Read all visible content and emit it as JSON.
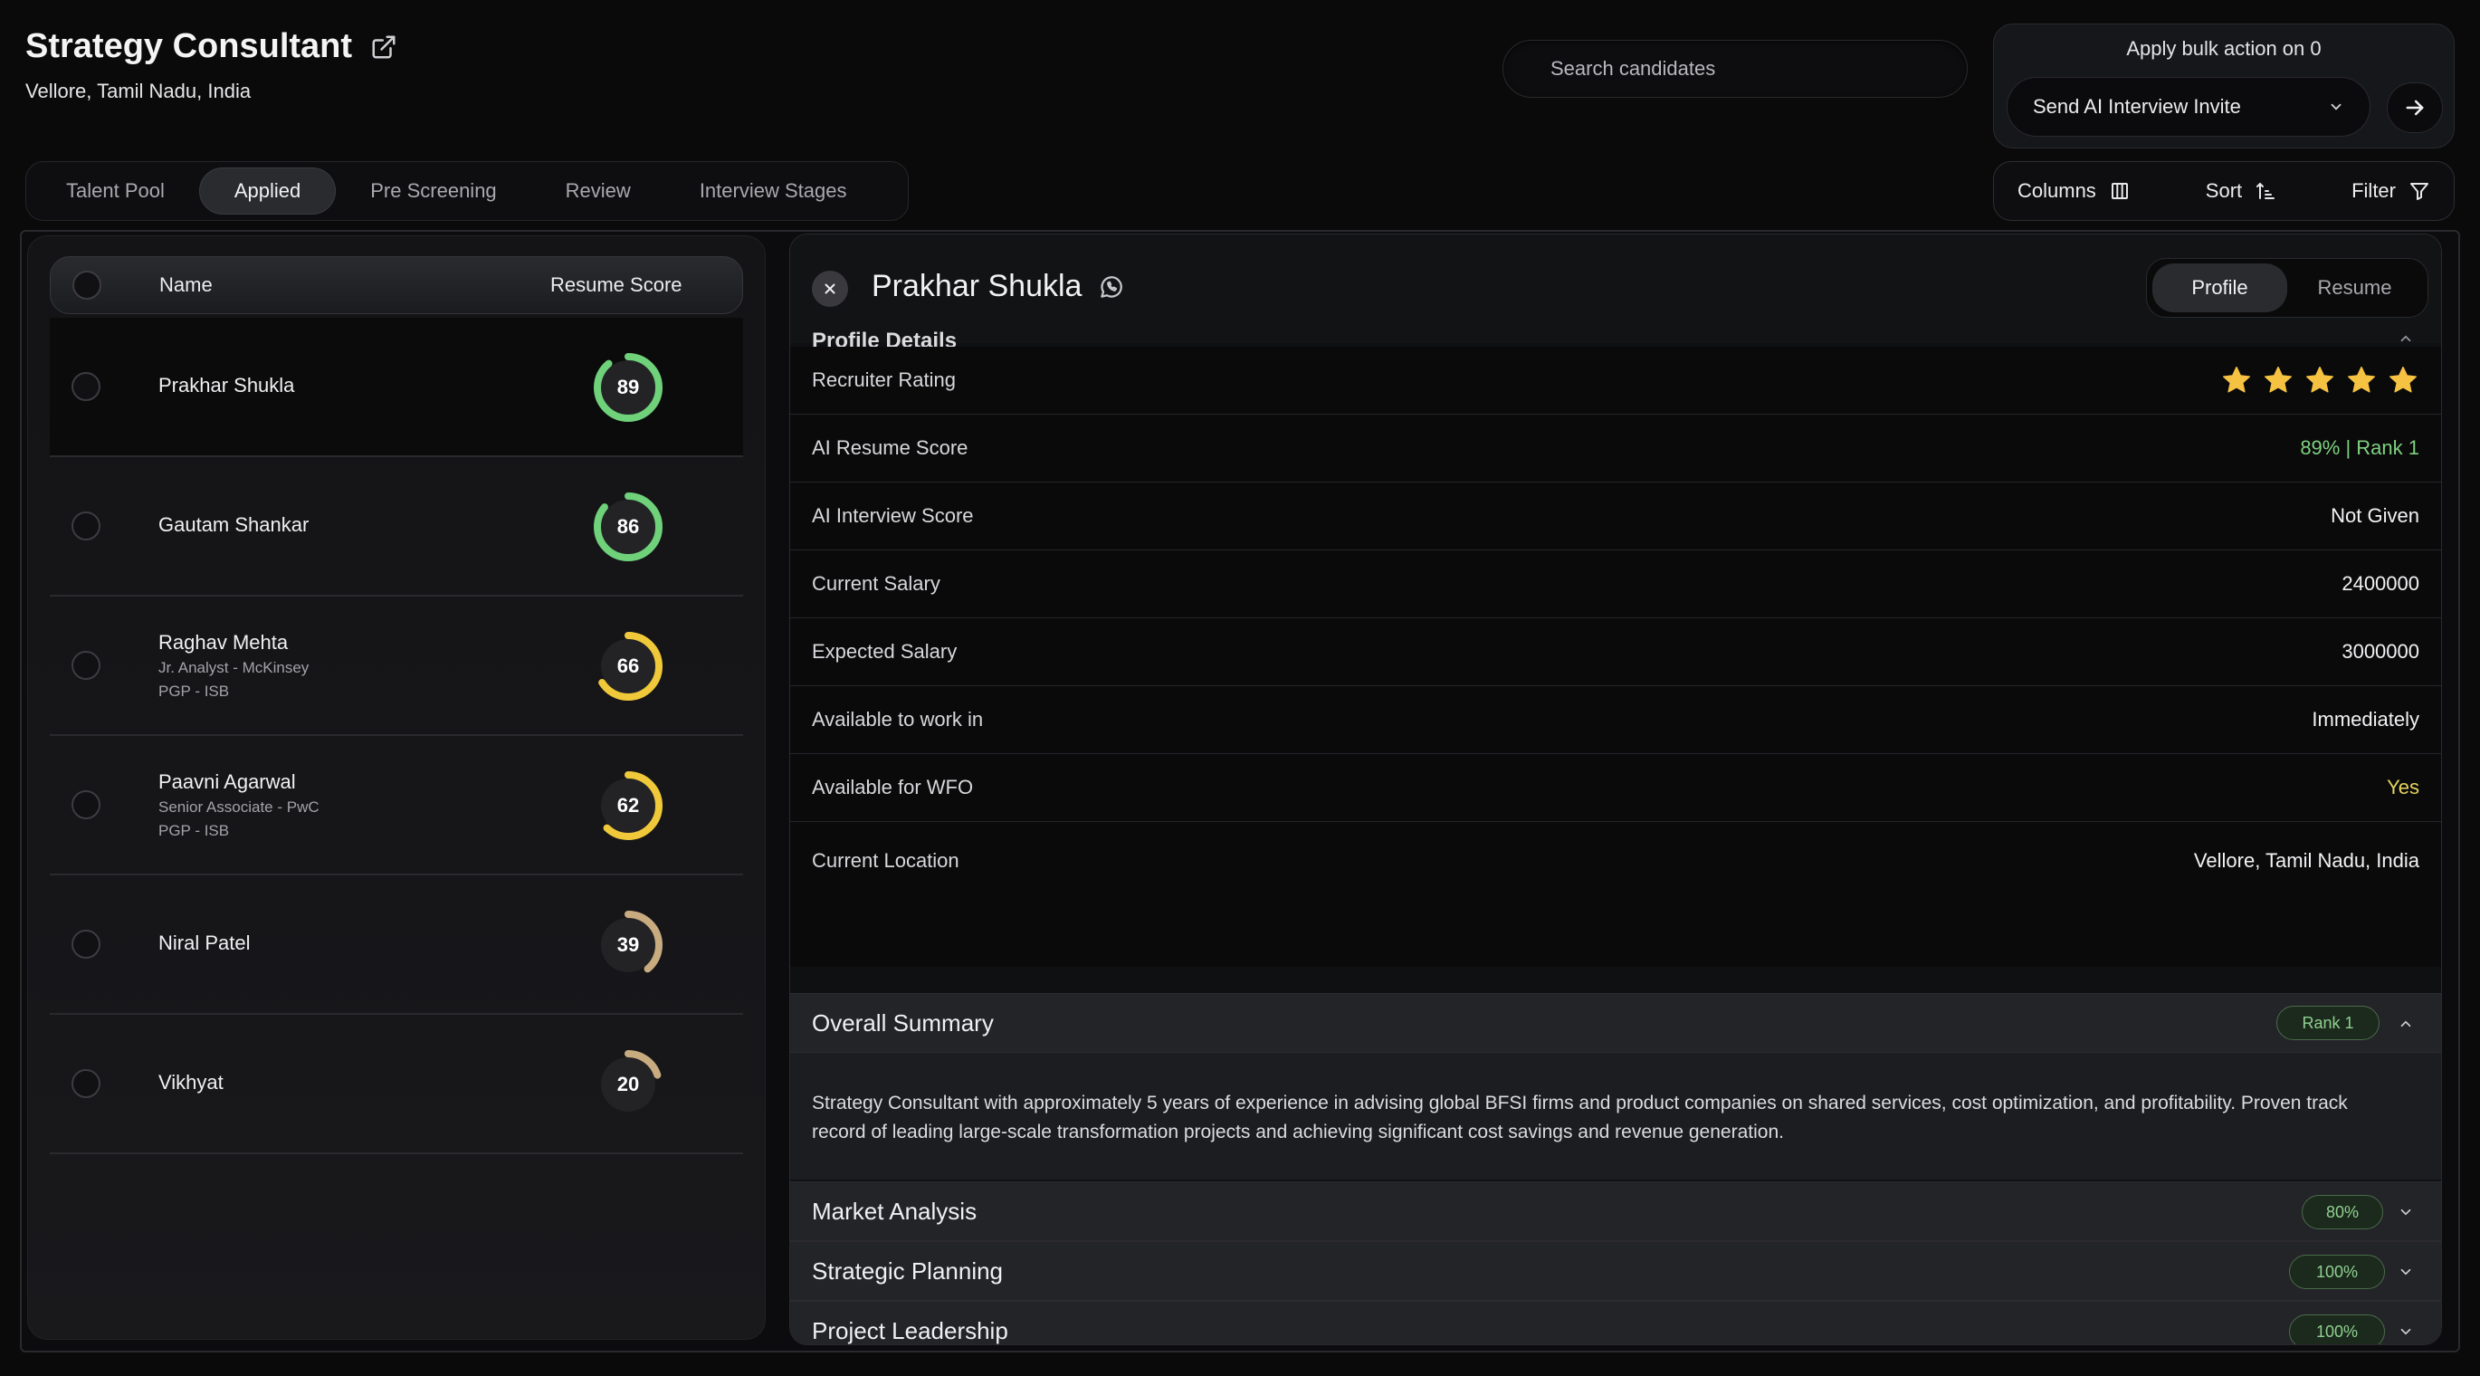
{
  "job": {
    "title": "Strategy Consultant",
    "location": "Vellore, Tamil Nadu, India"
  },
  "search": {
    "placeholder": "Search candidates"
  },
  "bulk": {
    "label": "Apply bulk action on 0",
    "action": "Send AI Interview Invite"
  },
  "tabs": [
    {
      "label": "Talent Pool"
    },
    {
      "label": "Applied"
    },
    {
      "label": "Pre Screening"
    },
    {
      "label": "Review"
    },
    {
      "label": "Interview Stages"
    }
  ],
  "tools": {
    "columns": "Columns",
    "sort": "Sort",
    "filter": "Filter"
  },
  "list": {
    "header": {
      "name": "Name",
      "score": "Resume Score"
    },
    "candidates": [
      {
        "name": "Prakhar Shukla",
        "role": "",
        "edu": "",
        "score": 89,
        "color": "#6fd17a"
      },
      {
        "name": "Gautam Shankar",
        "role": "",
        "edu": "",
        "score": 86,
        "color": "#6fd17a"
      },
      {
        "name": "Raghav Mehta",
        "role": "Jr. Analyst - McKinsey",
        "edu": "PGP - ISB",
        "score": 66,
        "color": "#f0c93a"
      },
      {
        "name": "Paavni Agarwal",
        "role": "Senior Associate - PwC",
        "edu": "PGP - ISB",
        "score": 62,
        "color": "#f0c93a"
      },
      {
        "name": "Niral Patel",
        "role": "",
        "edu": "",
        "score": 39,
        "color": "#c9ab80"
      },
      {
        "name": "Vikhyat",
        "role": "",
        "edu": "",
        "score": 20,
        "color": "#c9ab80"
      }
    ]
  },
  "detail": {
    "name": "Prakhar Shukla",
    "tab_profile": "Profile",
    "tab_resume": "Resume",
    "section_title": "Profile Details",
    "rating_stars": 5,
    "fields": [
      {
        "label": "Recruiter Rating",
        "value": ""
      },
      {
        "label": "AI Resume Score",
        "value": "89% | Rank 1"
      },
      {
        "label": "AI Interview Score",
        "value": "Not Given"
      },
      {
        "label": "Current Salary",
        "value": "2400000"
      },
      {
        "label": "Expected Salary",
        "value": "3000000"
      },
      {
        "label": "Available to work in",
        "value": "Immediately"
      },
      {
        "label": "Available for WFO",
        "value": "Yes"
      },
      {
        "label": "Current Location",
        "value": "Vellore, Tamil Nadu, India"
      }
    ],
    "summary": {
      "title": "Overall Summary",
      "badge": "Rank 1",
      "text": "Strategy Consultant with approximately 5 years of experience in advising global BFSI firms and product companies on shared services, cost optimization, and profitability. Proven track record of leading large-scale transformation projects and achieving significant cost savings and revenue generation."
    },
    "skills": [
      {
        "title": "Market Analysis",
        "badge": "80%"
      },
      {
        "title": "Strategic Planning",
        "badge": "100%"
      },
      {
        "title": "Project Leadership",
        "badge": "100%"
      }
    ]
  },
  "colors": {
    "green": "#7fd17f",
    "yellow": "#e5d35c",
    "star": "#f5c242"
  }
}
